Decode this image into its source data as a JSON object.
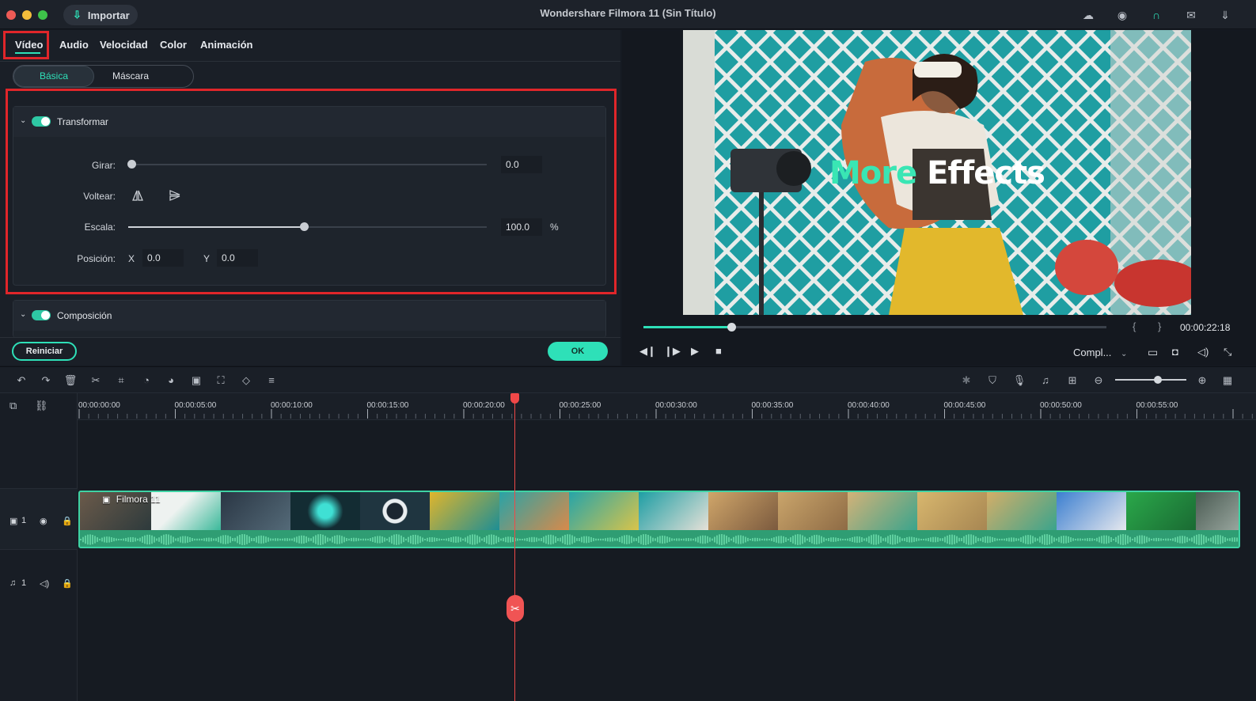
{
  "titlebar": {
    "title": "Wondershare Filmora 11 (Sin Título)",
    "import_label": "Importar",
    "icons": [
      "cloud-icon",
      "account-icon",
      "headset-icon",
      "mail-icon",
      "download-icon"
    ]
  },
  "tabs": [
    {
      "label": "Vídeo",
      "active": true
    },
    {
      "label": "Audio"
    },
    {
      "label": "Velocidad"
    },
    {
      "label": "Color"
    },
    {
      "label": "Animación"
    }
  ],
  "subtabs": {
    "basic": "Básica",
    "mask": "Máscara"
  },
  "transform": {
    "title": "Transformar",
    "enabled": true,
    "rotate_label": "Girar:",
    "rotate_value": "0.0",
    "rotate_fraction": 0.0,
    "flip_label": "Voltear:",
    "scale_label": "Escala:",
    "scale_value": "100.0",
    "scale_unit": "%",
    "scale_fraction": 0.49,
    "position_label": "Posición:",
    "pos_x_label": "X",
    "pos_x_value": "0.0",
    "pos_y_label": "Y",
    "pos_y_value": "0.0"
  },
  "composition": {
    "title": "Composición",
    "enabled": true
  },
  "buttons": {
    "reset": "Reiniciar",
    "ok": "OK"
  },
  "preview": {
    "overlay_word1": "More",
    "overlay_word2": "Effects",
    "timecode": "00:00:22:18",
    "progress_fraction": 0.19,
    "quality": "Compl...",
    "bracket_in": "{",
    "bracket_out": "}"
  },
  "timeline": {
    "ruler_labels": [
      "00:00:00:00",
      "00:00:05:00",
      "00:00:10:00",
      "00:00:15:00",
      "00:00:20:00",
      "00:00:25:00",
      "00:00:30:00",
      "00:00:35:00",
      "00:00:40:00",
      "00:00:45:00",
      "00:00:50:00",
      "00:00:55:00"
    ],
    "clip_name": "Filmora 11",
    "video_track_label": "1",
    "audio_track_label": "1",
    "zoom_fraction": 0.6
  },
  "colors": {
    "accent": "#2ee0b8",
    "highlight_box": "#e0262a",
    "playhead": "#f04848"
  }
}
